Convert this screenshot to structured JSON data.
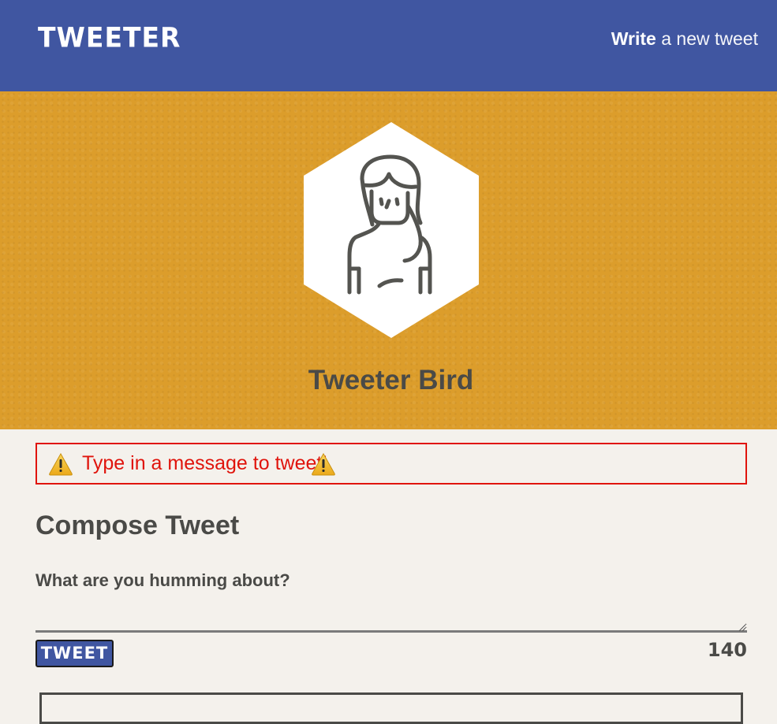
{
  "header": {
    "logo": "TWEETER",
    "write_bold": "Write",
    "write_rest": "a new tweet"
  },
  "profile": {
    "name": "Tweeter Bird",
    "avatar_icon": "woman-avatar-icon"
  },
  "error": {
    "message": "Type in a message to tweet!",
    "icon": "warning-icon",
    "color": "#e0140c"
  },
  "compose": {
    "title": "Compose Tweet",
    "label": "What are you humming about?",
    "textarea_value": "",
    "button_label": "TWEET",
    "counter": "140"
  },
  "colors": {
    "header_bg": "#4056a1",
    "hero_bg": "#dc9d2b",
    "page_bg": "#f4f1ec",
    "text_dark": "#4a4a47"
  }
}
